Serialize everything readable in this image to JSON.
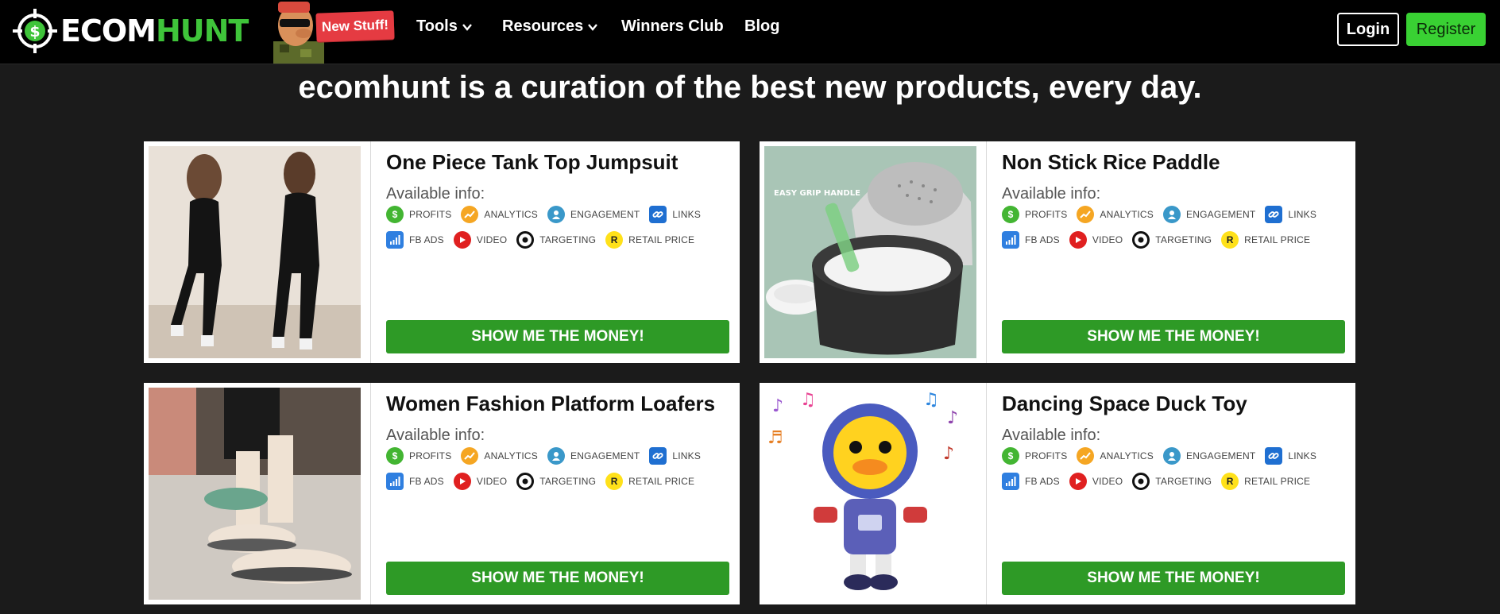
{
  "nav": {
    "logo_left": "ECOM",
    "logo_right": "HUNT",
    "new_badge": "New Stuff!",
    "links": [
      "Tools",
      "Resources",
      "Winners Club",
      "Blog"
    ],
    "login": "Login",
    "register": "Register"
  },
  "headline": "ecomhunt is a curation of the best new products, every day.",
  "info_tags": {
    "row1": [
      "PROFITS",
      "ANALYTICS",
      "ENGAGEMENT",
      "LINKS"
    ],
    "row2": [
      "FB ADS",
      "VIDEO",
      "TARGETING",
      "RETAIL PRICE"
    ],
    "retail_letter": "R"
  },
  "available_info_label": "Available info:",
  "cta_label": "SHOW ME THE MONEY!",
  "products": [
    {
      "title": "One Piece Tank Top Jumpsuit",
      "image": "black-jumpsuit-photo"
    },
    {
      "title": "Non Stick Rice Paddle",
      "image": "rice-cooker-paddle-photo"
    },
    {
      "title": "Women Fashion Platform Loafers",
      "image": "platform-loafers-photo"
    },
    {
      "title": "Dancing Space Duck Toy",
      "image": "space-duck-toy-photo"
    }
  ],
  "colors": {
    "background": "#1b1b1b",
    "cta_green": "#2e9a26",
    "register_green": "#39d133",
    "badge_red": "#e53b42"
  }
}
